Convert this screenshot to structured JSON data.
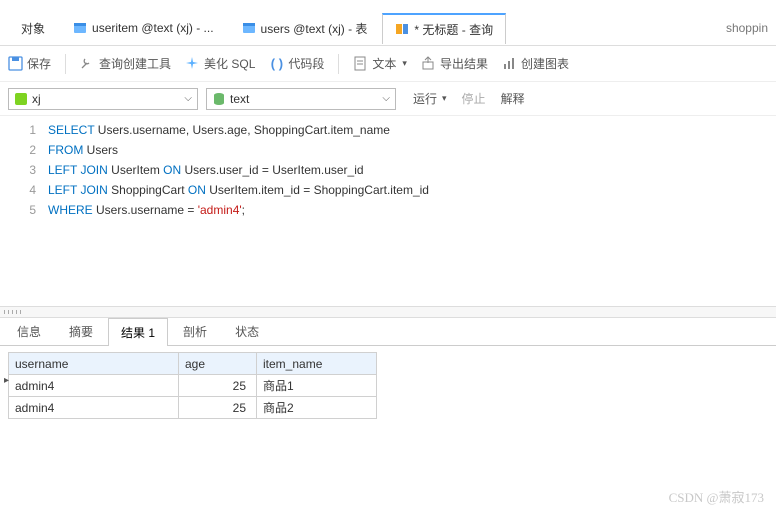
{
  "tabs": {
    "objects": "对象",
    "t1": "useritem @text (xj) - ...",
    "t2": "users @text (xj) - 表",
    "t3": "* 无标题 - 查询",
    "right": "shoppin"
  },
  "toolbar": {
    "save": "保存",
    "querybuilder": "查询创建工具",
    "beautify": "美化 SQL",
    "snippet": "代码段",
    "text": "文本",
    "export": "导出结果",
    "chart": "创建图表"
  },
  "conn": {
    "left": "xj",
    "right": "text"
  },
  "run": {
    "run": "运行",
    "stop": "停止",
    "explain": "解释"
  },
  "sql": {
    "l1a": "SELECT",
    "l1b": " Users.username, Users.age, ShoppingCart.item_name",
    "l2a": "FROM",
    "l2b": " Users",
    "l3a": "LEFT",
    "l3b": "JOIN",
    "l3c": " UserItem ",
    "l3d": "ON",
    "l3e": " Users.user_id = UserItem.user_id",
    "l4a": "LEFT",
    "l4b": "JOIN",
    "l4c": " ShoppingCart ",
    "l4d": "ON",
    "l4e": " UserItem.item_id = ShoppingCart.item_id",
    "l5a": "WHERE",
    "l5b": " Users.username = ",
    "l5c": "'admin4'",
    "l5d": ";"
  },
  "gutter": [
    "1",
    "2",
    "3",
    "4",
    "5"
  ],
  "restabs": {
    "info": "信息",
    "summary": "摘要",
    "result": "结果 1",
    "profile": "剖析",
    "status": "状态"
  },
  "grid": {
    "headers": {
      "user": "username",
      "age": "age",
      "item": "item_name"
    },
    "rows": [
      {
        "user": "admin4",
        "age": "25",
        "item": "商品1"
      },
      {
        "user": "admin4",
        "age": "25",
        "item": "商品2"
      }
    ]
  },
  "watermark": "CSDN @萧寂173"
}
